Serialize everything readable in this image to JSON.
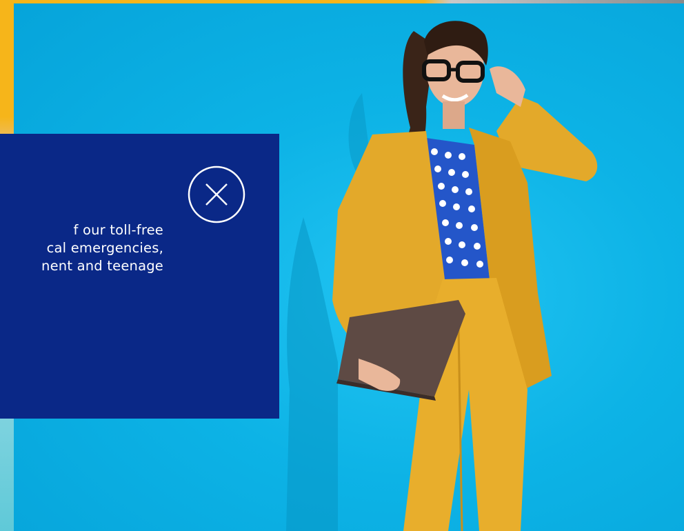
{
  "hero": {
    "image_description_icon": "woman-in-yellow-suit-photo",
    "accent_color": "#f6b51a",
    "background_color": "#0db3e6"
  },
  "modal": {
    "background_color": "#0a2887",
    "text_lines": [
      "f our toll-free",
      "cal emergencies,",
      "nent and teenage"
    ],
    "close_icon": "close-icon"
  }
}
